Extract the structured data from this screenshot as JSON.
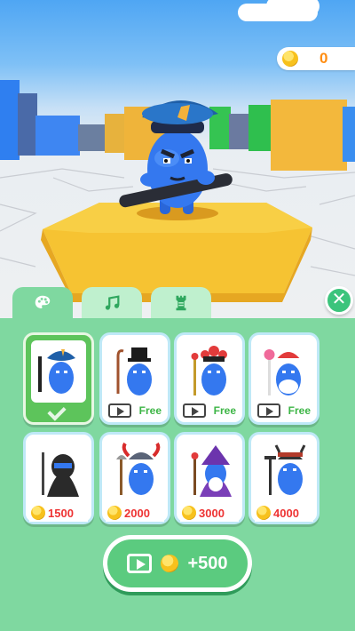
{
  "wallet": {
    "coins": "0",
    "coin_icon": "coin-icon"
  },
  "tabs": [
    {
      "name": "skins",
      "icon": "palette-icon",
      "active": true
    },
    {
      "name": "music",
      "icon": "music-note-icon",
      "active": false
    },
    {
      "name": "stages",
      "icon": "tower-icon",
      "active": false
    }
  ],
  "close": {
    "icon": "close-icon",
    "glyph": "✕"
  },
  "skins": [
    {
      "character": "police",
      "state": "selected"
    },
    {
      "character": "gentleman",
      "state": "free",
      "label": "Free"
    },
    {
      "character": "opera",
      "state": "free",
      "label": "Free"
    },
    {
      "character": "santa",
      "state": "free",
      "label": "Free"
    },
    {
      "character": "ninja",
      "state": "price",
      "price": "1500"
    },
    {
      "character": "viking",
      "state": "price",
      "price": "2000"
    },
    {
      "character": "wizard",
      "state": "price",
      "price": "3000"
    },
    {
      "character": "samurai",
      "state": "price",
      "price": "4000"
    }
  ],
  "reward_button": {
    "label": "+500",
    "icon": "video-icon"
  },
  "colors": {
    "panel": "#7fd8a0",
    "accent": "#3cc47c",
    "price": "#ee3333",
    "coin_text": "#ff8d12"
  }
}
